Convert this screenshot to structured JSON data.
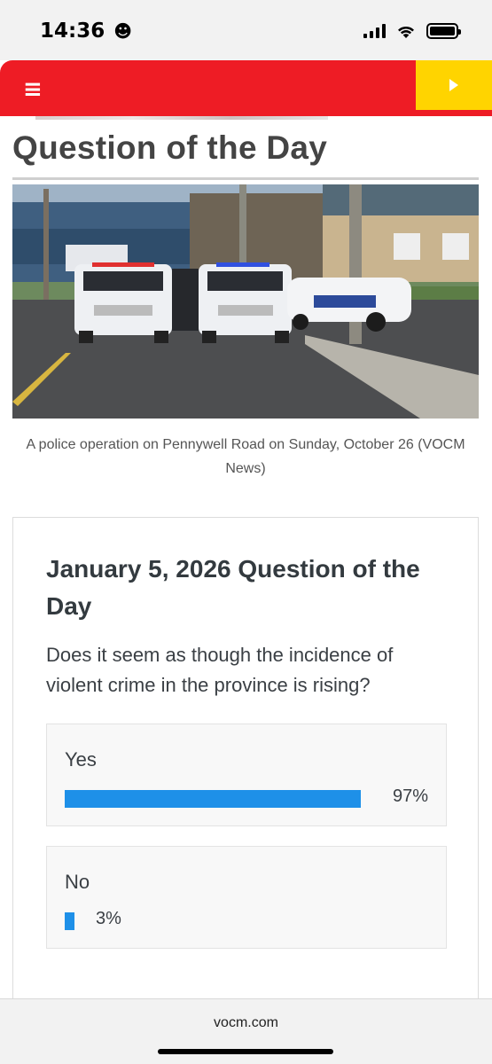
{
  "status_bar": {
    "time": "14:36",
    "emoji": "☻",
    "icons": [
      "signal-icon",
      "wifi-icon",
      "battery-icon"
    ]
  },
  "header": {
    "menu_icon": "≡",
    "brand_color": "#ee1c25",
    "accent_color": "#ffd400"
  },
  "article": {
    "title": "Question of the Day",
    "caption": "A police operation on Pennywell Road on Sunday, October 26 (VOCM News)"
  },
  "poll": {
    "title": "January 5, 2026 Question of the Day",
    "question": "Does it seem as though the incidence of violent crime in the province is rising?",
    "bar_color": "#1e90e8",
    "options": [
      {
        "label": "Yes",
        "percent_text": "97%",
        "percent": 97
      },
      {
        "label": "No",
        "percent_text": "3%",
        "percent": 3
      }
    ]
  },
  "browser": {
    "url": "vocm.com"
  }
}
